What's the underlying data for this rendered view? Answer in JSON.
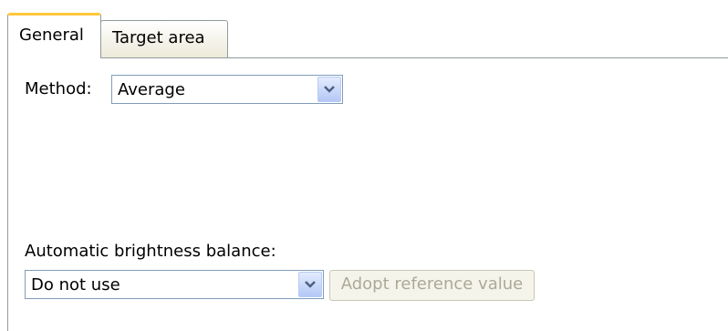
{
  "tabs": [
    {
      "label": "General",
      "active": true
    },
    {
      "label": "Target area",
      "active": false
    }
  ],
  "method": {
    "label": "Method:",
    "value": "Average"
  },
  "brightness": {
    "label": "Automatic brightness balance:",
    "value": "Do not use"
  },
  "adopt_button": {
    "label": "Adopt reference value",
    "enabled": false
  },
  "colors": {
    "active_tab_accent": "#ffc83c",
    "border": "#919b9c",
    "disabled_text": "#aca899"
  }
}
